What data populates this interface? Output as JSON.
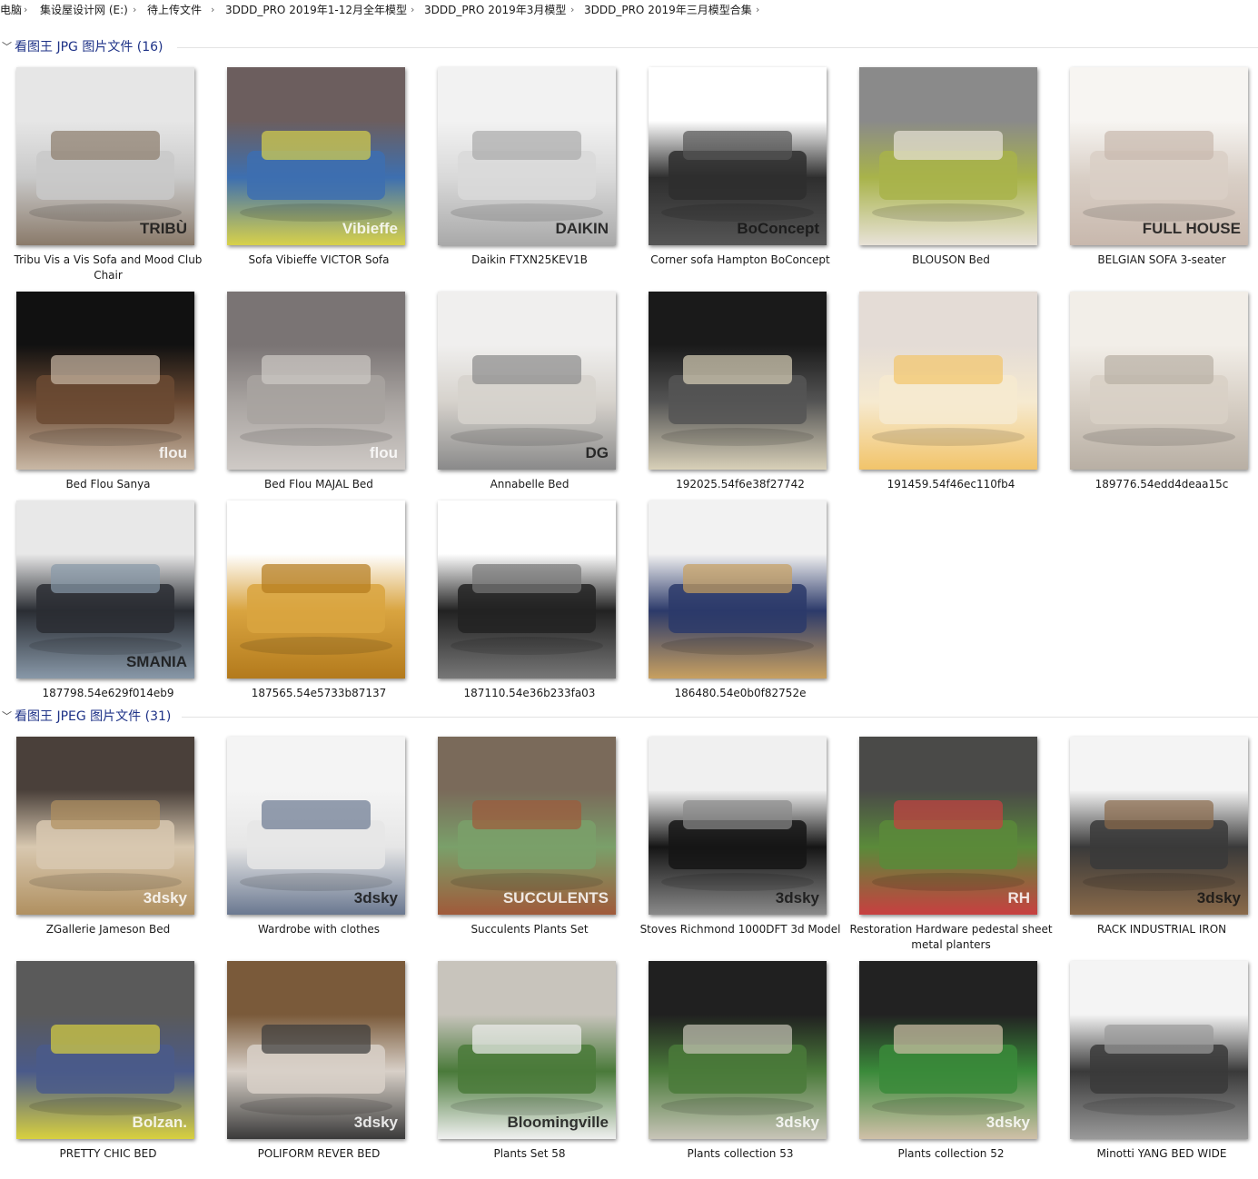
{
  "breadcrumb": {
    "items": [
      "电脑",
      "集设屋设计网 (E:)",
      "待上传文件",
      "3DDD_PRO 2019年1-12月全年模型",
      "3DDD_PRO 2019年3月模型",
      "3DDD_PRO 2019年三月模型合集"
    ],
    "separator": "›"
  },
  "groups": [
    {
      "title": "看图王 JPG 图片文件 (16)",
      "items": [
        {
          "name": "Tribu Vis a Vis Sofa and Mood Club Chair",
          "brand": "TRIBÙ",
          "palette": [
            "#e6e6e6",
            "#c9c9c9",
            "#8a7a6a"
          ]
        },
        {
          "name": "Sofa Vibieffe VICTOR Sofa",
          "brand": "Vibieffe",
          "palette": [
            "#6c5e5e",
            "#3d6fb0",
            "#d8d14a"
          ]
        },
        {
          "name": "Daikin FTXN25KEV1B",
          "brand": "DAIKIN",
          "palette": [
            "#f2f2f2",
            "#d9d9d9",
            "#a9a9a9"
          ]
        },
        {
          "name": "Corner sofa Hampton BoConcept",
          "brand": "BoConcept",
          "palette": [
            "#ffffff",
            "#2e2e2e",
            "#555555"
          ]
        },
        {
          "name": "BLOUSON Bed",
          "brand": "",
          "palette": [
            "#8a8a8a",
            "#a8b34a",
            "#e8e2d8"
          ]
        },
        {
          "name": "BELGIAN SOFA 3-seater",
          "brand": "FULL HOUSE",
          "palette": [
            "#f7f5f2",
            "#d9cfc6",
            "#c8b8ad"
          ]
        },
        {
          "name": "Bed Flou Sanya",
          "brand": "flou",
          "palette": [
            "#111111",
            "#6b4a33",
            "#c9b8a5"
          ]
        },
        {
          "name": "Bed Flou MAJAL Bed",
          "brand": "flou",
          "palette": [
            "#7a7474",
            "#a8a3a0",
            "#cfcac6"
          ]
        },
        {
          "name": "Annabelle Bed",
          "brand": "DG",
          "palette": [
            "#f0efee",
            "#d6d2cc",
            "#8a8a8a"
          ]
        },
        {
          "name": "192025.54f6e38f27742",
          "brand": "",
          "palette": [
            "#1a1a1a",
            "#555555",
            "#d8d0b8"
          ]
        },
        {
          "name": "191459.54f46ec110fb4",
          "brand": "",
          "palette": [
            "#e4dcd6",
            "#f6ead0",
            "#f2c46a"
          ]
        },
        {
          "name": "189776.54edd4deaa15c",
          "brand": "",
          "palette": [
            "#f2eee8",
            "#d8d0c6",
            "#b8afa4"
          ]
        },
        {
          "name": "187798.54e629f014eb9",
          "brand": "SMANIA",
          "palette": [
            "#e8e8e8",
            "#2a2d33",
            "#8898a8"
          ]
        },
        {
          "name": "187565.54e5733b87137",
          "brand": "",
          "palette": [
            "#ffffff",
            "#d9a440",
            "#b37a1c"
          ]
        },
        {
          "name": "187110.54e36b233fa03",
          "brand": "",
          "palette": [
            "#ffffff",
            "#222222",
            "#777777"
          ]
        },
        {
          "name": "186480.54e0b0f82752e",
          "brand": "",
          "palette": [
            "#f2f2f2",
            "#2c3a6a",
            "#c8a060"
          ]
        }
      ]
    },
    {
      "title": "看图王 JPEG 图片文件 (31)",
      "items": [
        {
          "name": "ZGallerie Jameson Bed",
          "brand": "3dsky",
          "palette": [
            "#4a403a",
            "#d8c8b0",
            "#b09060"
          ]
        },
        {
          "name": "Wardrobe with clothes",
          "brand": "3dsky",
          "palette": [
            "#f4f4f4",
            "#e6e6e6",
            "#6a7890"
          ]
        },
        {
          "name": "Succulents Plants Set",
          "brand": "SUCCULENTS",
          "palette": [
            "#7a6a5a",
            "#7aa06a",
            "#a05a3a"
          ]
        },
        {
          "name": "Stoves Richmond 1000DFT 3d Model",
          "brand": "3dsky",
          "palette": [
            "#f0f0f0",
            "#151515",
            "#8a8a8a"
          ]
        },
        {
          "name": "Restoration Hardware pedestal sheet metal planters",
          "brand": "RH",
          "palette": [
            "#4a4a48",
            "#5a8a3a",
            "#c84040"
          ]
        },
        {
          "name": "RACK INDUSTRIAL IRON",
          "brand": "3dsky",
          "palette": [
            "#f4f4f4",
            "#3a3a3a",
            "#8a6a4a"
          ]
        },
        {
          "name": "PRETTY CHIC BED",
          "brand": "Bolzan.",
          "palette": [
            "#5a5a5a",
            "#4a5a8a",
            "#d8d040"
          ]
        },
        {
          "name": "POLIFORM REVER BED",
          "brand": "3dsky",
          "palette": [
            "#7a5a3a",
            "#d8d0c8",
            "#3a3a3a"
          ]
        },
        {
          "name": "Plants Set 58",
          "brand": "Bloomingville",
          "palette": [
            "#c8c4bc",
            "#4a7a3a",
            "#f0f0f0"
          ]
        },
        {
          "name": "Plants collection 53",
          "brand": "3dsky",
          "palette": [
            "#202020",
            "#4a7a3a",
            "#c8c4b8"
          ]
        },
        {
          "name": "Plants collection 52",
          "brand": "3dsky",
          "palette": [
            "#222222",
            "#3a8a3a",
            "#d0c0a8"
          ]
        },
        {
          "name": "Minotti YANG BED WIDE",
          "brand": "",
          "palette": [
            "#f4f4f4",
            "#3a3a3a",
            "#9a9a9a"
          ]
        }
      ]
    }
  ]
}
